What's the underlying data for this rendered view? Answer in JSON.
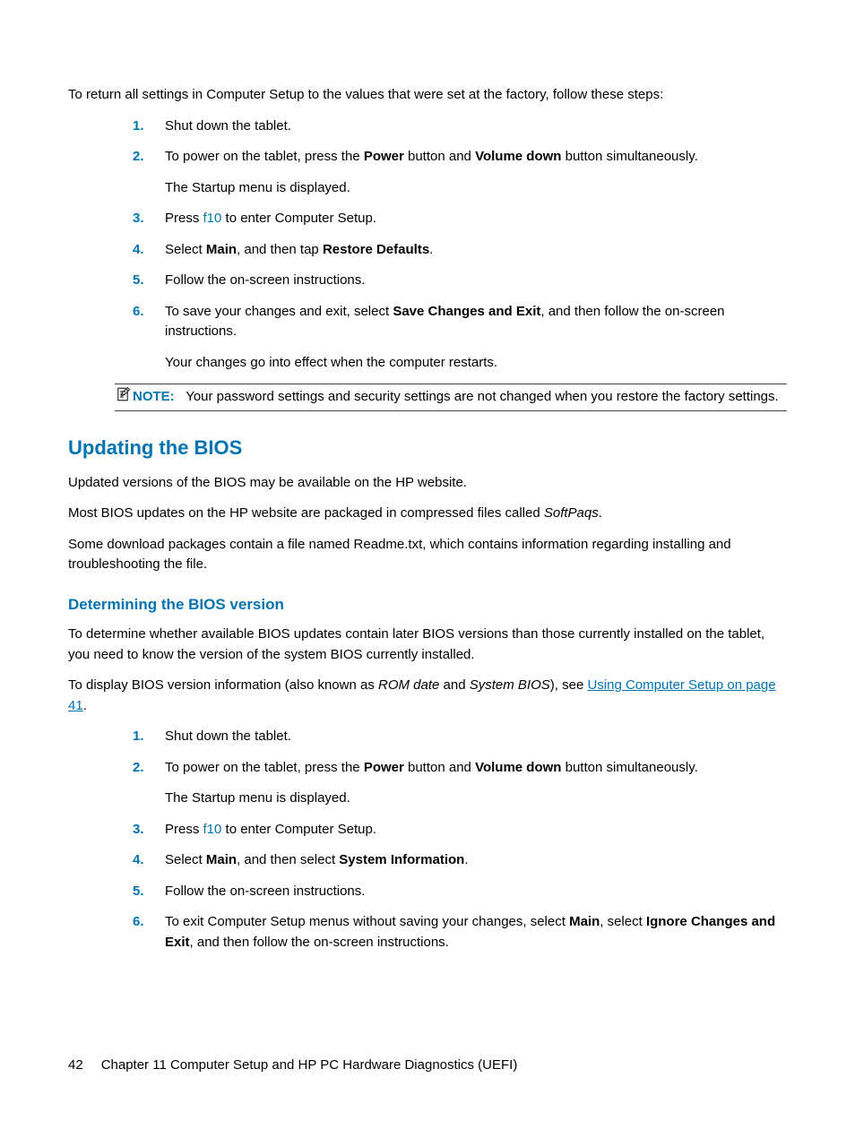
{
  "intro": "To return all settings in Computer Setup to the values that were set at the factory, follow these steps:",
  "list1": {
    "i1": {
      "n": "1.",
      "t": "Shut down the tablet."
    },
    "i2": {
      "n": "2.",
      "pre": "To power on the tablet, press the ",
      "b1": "Power",
      "mid": " button and ",
      "b2": "Volume down",
      "post": " button simultaneously.",
      "sub": "The Startup menu is displayed."
    },
    "i3": {
      "n": "3.",
      "pre": "Press ",
      "key": "f10",
      "post": " to enter Computer Setup."
    },
    "i4": {
      "n": "4.",
      "pre": "Select ",
      "b1": "Main",
      "mid": ", and then tap ",
      "b2": "Restore Defaults",
      "post": "."
    },
    "i5": {
      "n": "5.",
      "t": "Follow the on-screen instructions."
    },
    "i6": {
      "n": "6.",
      "pre": "To save your changes and exit, select ",
      "b1": "Save Changes and Exit",
      "post": ", and then follow the on-screen instructions.",
      "sub": "Your changes go into effect when the computer restarts."
    }
  },
  "note": {
    "label": "NOTE:",
    "text": "Your password settings and security settings are not changed when you restore the factory settings."
  },
  "h2": "Updating the BIOS",
  "updating": {
    "p1": "Updated versions of the BIOS may be available on the HP website.",
    "p2_pre": "Most BIOS updates on the HP website are packaged in compressed files called ",
    "p2_i": "SoftPaqs",
    "p2_post": ".",
    "p3": "Some download packages contain a file named Readme.txt, which contains information regarding installing and troubleshooting the file."
  },
  "h3": "Determining the BIOS version",
  "det": {
    "p1": "To determine whether available BIOS updates contain later BIOS versions than those currently installed on the tablet, you need to know the version of the system BIOS currently installed.",
    "p2_pre": "To display BIOS version information (also known as ",
    "p2_i1": "ROM date",
    "p2_mid": " and ",
    "p2_i2": "System BIOS",
    "p2_paren": "), see ",
    "p2_link": "Using Computer Setup on page 41",
    "p2_end": "."
  },
  "list2": {
    "i1": {
      "n": "1.",
      "t": "Shut down the tablet."
    },
    "i2": {
      "n": "2.",
      "pre": "To power on the tablet, press the ",
      "b1": "Power",
      "mid": " button and ",
      "b2": "Volume down",
      "post": " button simultaneously.",
      "sub": "The Startup menu is displayed."
    },
    "i3": {
      "n": "3.",
      "pre": "Press ",
      "key": "f10",
      "post": " to enter Computer Setup."
    },
    "i4": {
      "n": "4.",
      "pre": "Select ",
      "b1": "Main",
      "mid": ", and then select ",
      "b2": "System Information",
      "post": "."
    },
    "i5": {
      "n": "5.",
      "t": "Follow the on-screen instructions."
    },
    "i6": {
      "n": "6.",
      "pre": "To exit Computer Setup menus without saving your changes, select ",
      "b1": "Main",
      "mid": ", select ",
      "b2": "Ignore Changes and Exit",
      "post": ", and then follow the on-screen instructions."
    }
  },
  "footer": {
    "page": "42",
    "chapter": "Chapter 11   Computer Setup and HP PC Hardware Diagnostics (UEFI)"
  }
}
